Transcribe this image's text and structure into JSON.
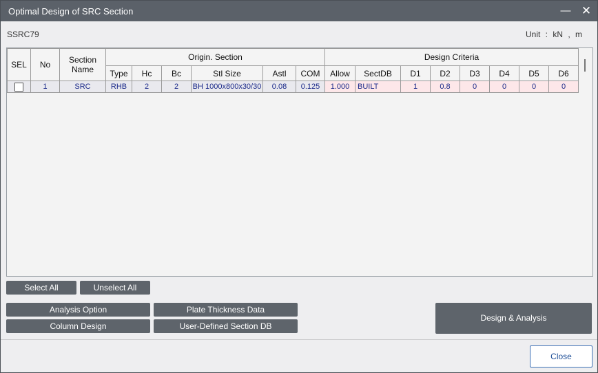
{
  "window": {
    "title": "Optimal Design of SRC Section",
    "minimize_glyph": "—",
    "close_glyph": "✕"
  },
  "section_id": "SSRC79",
  "unit": {
    "text": "Unit :  kN  ,  m"
  },
  "table": {
    "group_headers": {
      "sel": "SEL",
      "no": "No",
      "section_name": "Section Name",
      "origin_section": "Origin. Section",
      "design_criteria": "Design Criteria"
    },
    "sub_headers": [
      "Type",
      "Hc",
      "Bc",
      "Stl Size",
      "Astl",
      "COM",
      "Allow",
      "SectDB",
      "D1",
      "D2",
      "D3",
      "D4",
      "D5",
      "D6"
    ],
    "rows": [
      {
        "selected": false,
        "cells": [
          "1",
          "SRC",
          "RHB",
          "2",
          "2",
          "BH 1000x800x30/30",
          "0.08",
          "0.125",
          "1.000",
          "BUILT",
          "1",
          "0.8",
          "0",
          "0",
          "0",
          "0"
        ]
      }
    ]
  },
  "buttons": {
    "select_all": "Select All",
    "unselect_all": "Unselect All",
    "analysis_option": "Analysis Option",
    "plate_thickness": "Plate Thickness Data",
    "column_design": "Column Design",
    "user_defined_db": "User-Defined Section DB",
    "design_analysis": "Design & Analysis",
    "close": "Close"
  },
  "colors": {
    "titlebar": "#5b6169",
    "button": "#5e646b",
    "criteria_cell": "#fde7e9",
    "close_border": "#3a6fb5"
  }
}
